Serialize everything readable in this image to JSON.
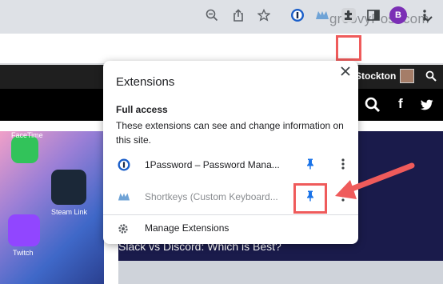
{
  "watermark": "groovyPost.com",
  "toolbar": {
    "icons": [
      "zoom-icon",
      "share-icon",
      "bookmark-star-icon",
      "1password-icon",
      "shortkeys-icon",
      "extensions-puzzle-icon",
      "side-panel-icon",
      "more-menu-icon"
    ],
    "profile_initial": "B"
  },
  "page": {
    "user_name": "Stockton",
    "nav_icons": [
      "search-icon",
      "facebook-icon",
      "twitter-icon"
    ],
    "facebook_glyph": "f",
    "article_title": "Slack vs Discord: Which is Best?",
    "apps": [
      {
        "label": "FaceTime"
      },
      {
        "label": "Steam Link"
      },
      {
        "label": "Twitch"
      }
    ]
  },
  "extensions_popup": {
    "title": "Extensions",
    "section_title": "Full access",
    "section_description": "These extensions can see and change information on this site.",
    "extensions": [
      {
        "name": "1Password – Password Mana...",
        "pinned": true
      },
      {
        "name": "Shortkeys (Custom Keyboard...",
        "pinned": true
      }
    ],
    "manage_label": "Manage Extensions"
  },
  "colors": {
    "accent_blue": "#1a73e8",
    "highlight_red": "#ef5b5b",
    "profile_purple": "#7b2fb5"
  }
}
